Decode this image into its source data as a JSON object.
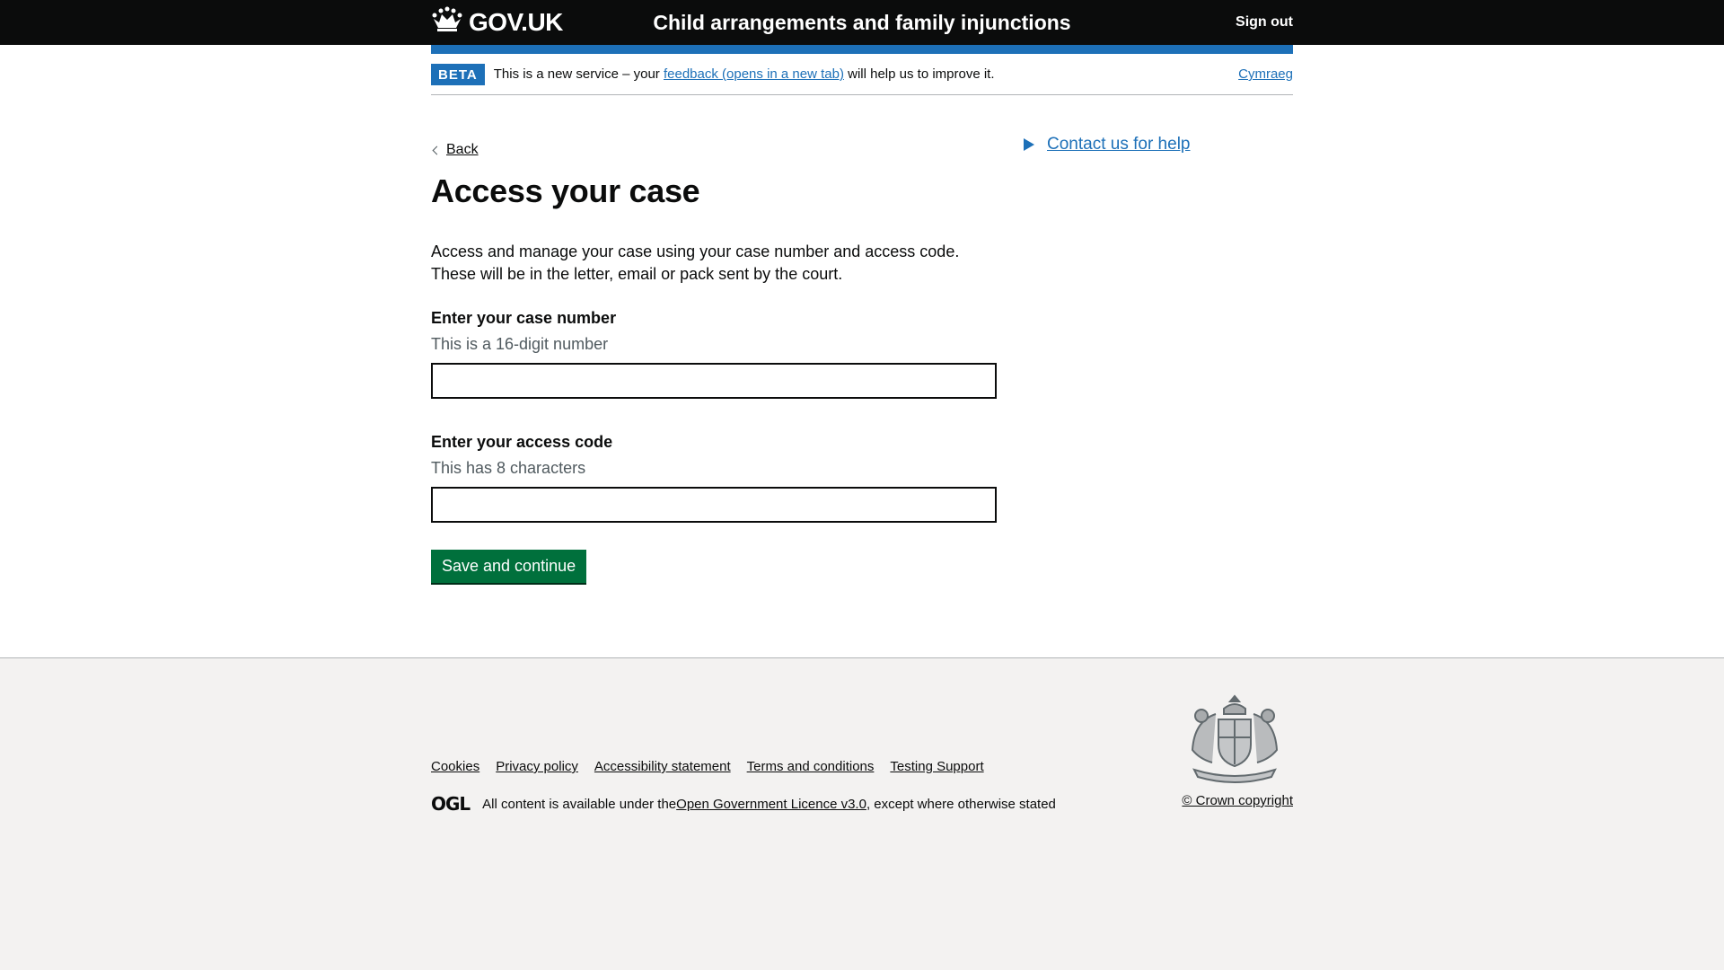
{
  "header": {
    "logo_text": "GOV.UK",
    "service_name": "Child arrangements and family injunctions",
    "sign_out": "Sign out"
  },
  "phase_banner": {
    "tag": "BETA",
    "text_before": "This is a new service – your ",
    "feedback_link": "feedback (opens in a new tab)",
    "text_after": " will help us to improve it.",
    "language_link": "Cymraeg"
  },
  "main": {
    "back_link": "Back",
    "title": "Access your case",
    "description_line1": "Access and manage your case using your case number and access code.",
    "description_line2": "These will be in the letter, email or pack sent by the court.",
    "case_number": {
      "label": "Enter your case number",
      "hint": "This is a 16-digit number",
      "value": ""
    },
    "access_code": {
      "label": "Enter your access code",
      "hint": "This has 8 characters",
      "value": ""
    },
    "submit_label": "Save and continue"
  },
  "sidebar": {
    "contact_link": "Contact us for help"
  },
  "footer": {
    "links": [
      "Cookies",
      "Privacy policy",
      "Accessibility statement",
      "Terms and conditions",
      "Testing Support"
    ],
    "ogl_logo": "OGL",
    "licence_before": "All content is available under the ",
    "licence_link": "Open Government Licence v3.0",
    "licence_after": ", except where otherwise stated",
    "copyright": "© Crown copyright"
  },
  "colors": {
    "header_bg": "#0b0c0c",
    "brand_blue": "#1d70b8",
    "button_green": "#00703c",
    "footer_bg": "#f3f2f1"
  },
  "icons": {
    "logo": "crown-icon",
    "back": "chevron-left-icon",
    "details": "triangle-right-icon",
    "crest": "royal-coat-of-arms-icon"
  }
}
